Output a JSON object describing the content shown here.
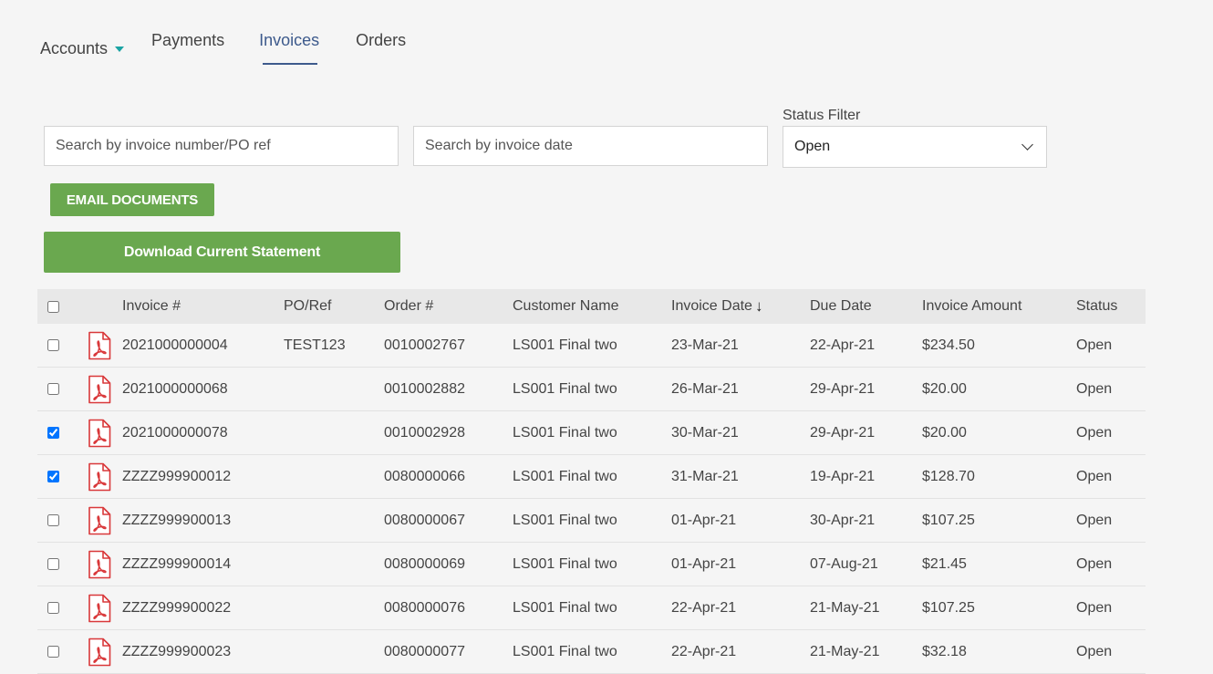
{
  "nav": {
    "accounts": "Accounts",
    "payments": "Payments",
    "invoices": "Invoices",
    "orders": "Orders"
  },
  "filters": {
    "search_invoice_placeholder": "Search by invoice number/PO ref",
    "search_date_placeholder": "Search by invoice date",
    "status_label": "Status Filter",
    "status_value": "Open"
  },
  "buttons": {
    "email": "EMAIL DOCUMENTS",
    "download": "Download Current Statement"
  },
  "table": {
    "headers": {
      "invoice": "Invoice #",
      "po": "PO/Ref",
      "order": "Order #",
      "customer": "Customer Name",
      "invoice_date": "Invoice Date",
      "due_date": "Due Date",
      "amount": "Invoice Amount",
      "status": "Status"
    },
    "sort_icon": "arrow-down-icon",
    "rows": [
      {
        "checked": false,
        "invoice": "2021000000004",
        "po": "TEST123",
        "order": "0010002767",
        "customer": "LS001 Final two",
        "invoice_date": "23-Mar-21",
        "due_date": "22-Apr-21",
        "amount": "$234.50",
        "status": "Open"
      },
      {
        "checked": false,
        "invoice": "2021000000068",
        "po": "",
        "order": "0010002882",
        "customer": "LS001 Final two",
        "invoice_date": "26-Mar-21",
        "due_date": "29-Apr-21",
        "amount": "$20.00",
        "status": "Open"
      },
      {
        "checked": true,
        "invoice": "2021000000078",
        "po": "",
        "order": "0010002928",
        "customer": "LS001 Final two",
        "invoice_date": "30-Mar-21",
        "due_date": "29-Apr-21",
        "amount": "$20.00",
        "status": "Open"
      },
      {
        "checked": true,
        "invoice": "ZZZZ999900012",
        "po": "",
        "order": "0080000066",
        "customer": "LS001 Final two",
        "invoice_date": "31-Mar-21",
        "due_date": "19-Apr-21",
        "amount": "$128.70",
        "status": "Open"
      },
      {
        "checked": false,
        "invoice": "ZZZZ999900013",
        "po": "",
        "order": "0080000067",
        "customer": "LS001 Final two",
        "invoice_date": "01-Apr-21",
        "due_date": "30-Apr-21",
        "amount": "$107.25",
        "status": "Open"
      },
      {
        "checked": false,
        "invoice": "ZZZZ999900014",
        "po": "",
        "order": "0080000069",
        "customer": "LS001 Final two",
        "invoice_date": "01-Apr-21",
        "due_date": "07-Aug-21",
        "amount": "$21.45",
        "status": "Open"
      },
      {
        "checked": false,
        "invoice": "ZZZZ999900022",
        "po": "",
        "order": "0080000076",
        "customer": "LS001 Final two",
        "invoice_date": "22-Apr-21",
        "due_date": "21-May-21",
        "amount": "$107.25",
        "status": "Open"
      },
      {
        "checked": false,
        "invoice": "ZZZZ999900023",
        "po": "",
        "order": "0080000077",
        "customer": "LS001 Final two",
        "invoice_date": "22-Apr-21",
        "due_date": "21-May-21",
        "amount": "$32.18",
        "status": "Open"
      }
    ]
  },
  "colors": {
    "accent_green": "#6aa84f",
    "active_tab": "#3d5a8c",
    "pdf_red": "#d9383a",
    "caret_teal": "#1aa3a3"
  }
}
